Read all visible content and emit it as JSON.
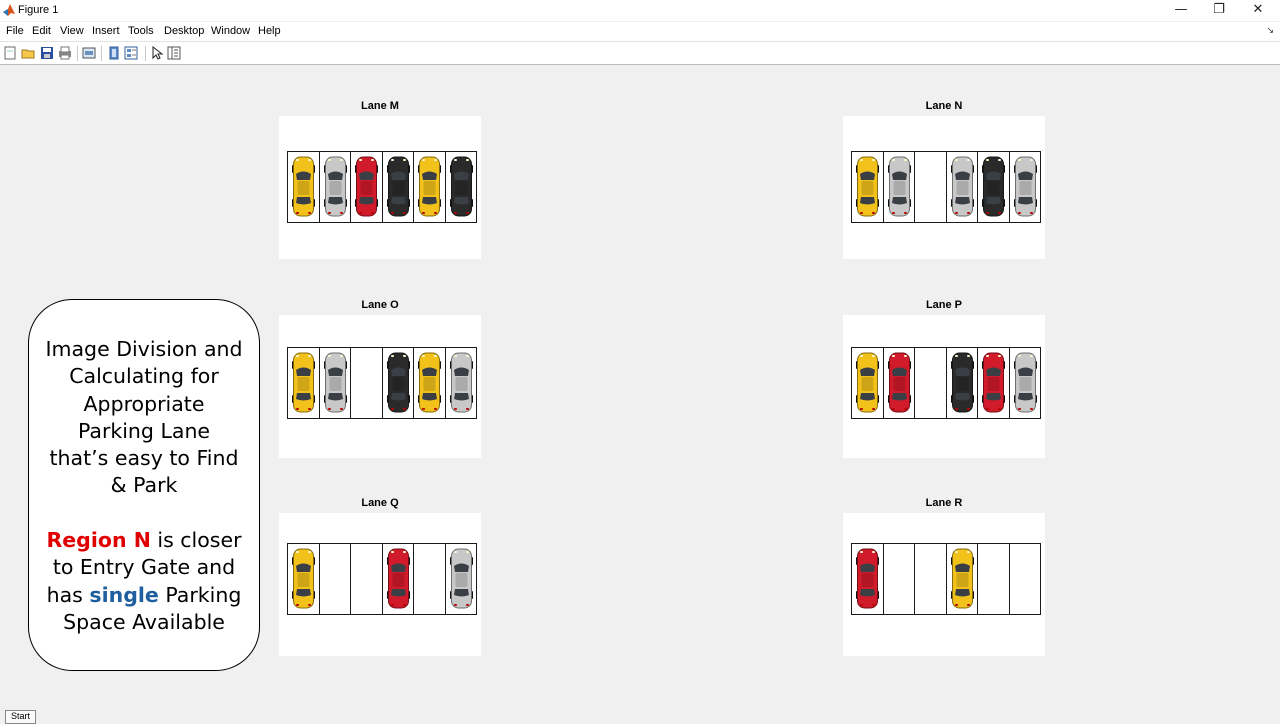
{
  "window": {
    "title": "Figure 1",
    "app_icon": "matlab-logo-icon",
    "controls": [
      "minimize-icon",
      "restore-icon",
      "close-icon"
    ]
  },
  "menu": {
    "items": [
      "File",
      "Edit",
      "View",
      "Insert",
      "Tools",
      "Desktop",
      "Window",
      "Help"
    ]
  },
  "toolbar": {
    "icons": [
      "new-figure-icon",
      "open-file-icon",
      "save-icon",
      "print-icon",
      "link-plot-icon",
      "hide-plot-tools-icon",
      "show-plot-tools-icon",
      "edit-plot-icon",
      "insert-colorbar-icon"
    ]
  },
  "car_colors": {
    "yellow": "#f2c21a",
    "silver": "#c8c8c8",
    "red": "#d11a2a",
    "black": "#2a2a2a"
  },
  "lanes": [
    {
      "title": "Lane M",
      "slots": [
        "yellow",
        "silver",
        "red",
        "black",
        "yellow",
        "black"
      ]
    },
    {
      "title": "Lane N",
      "slots": [
        "yellow",
        "silver",
        "empty",
        "silver",
        "black",
        "silver"
      ]
    },
    {
      "title": "Lane O",
      "slots": [
        "yellow",
        "silver",
        "empty",
        "black",
        "yellow",
        "silver"
      ]
    },
    {
      "title": "Lane P",
      "slots": [
        "yellow",
        "red",
        "empty",
        "black",
        "red",
        "silver"
      ]
    },
    {
      "title": "Lane Q",
      "slots": [
        "yellow",
        "empty",
        "empty",
        "red",
        "empty",
        "silver"
      ]
    },
    {
      "title": "Lane R",
      "slots": [
        "red",
        "empty",
        "empty",
        "yellow",
        "empty",
        "empty"
      ]
    }
  ],
  "annotation": {
    "line1": "Image Division and",
    "line2": "Calculating for",
    "line3": "Appropriate",
    "line4": "Parking Lane",
    "line5": "that’s easy to Find",
    "line6": "& Park",
    "region_label": "Region N",
    "after_region": " is closer",
    "line8": "to Entry Gate and",
    "has_text": "has ",
    "single_text": "single",
    "after_single": " Parking",
    "line10": "Space Available"
  },
  "start_button": "Start"
}
